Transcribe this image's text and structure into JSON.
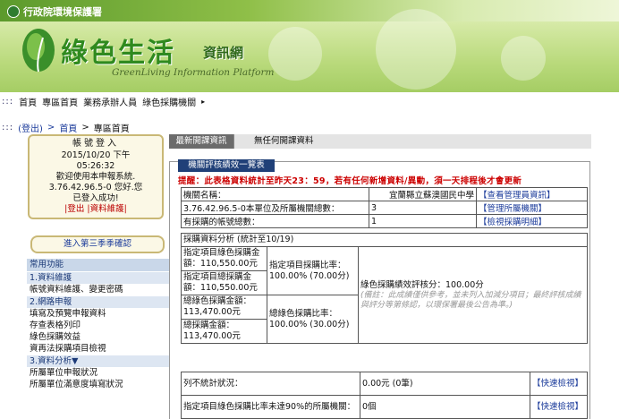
{
  "banner": {
    "agency": "行政院環境保護署",
    "title": "綠色生活",
    "title_sub": "資訊網",
    "tagline": "GreenLiving Information Platform"
  },
  "topnav": {
    "dots": ":::",
    "items": [
      "首頁",
      "專區首頁",
      "業務承辦人員",
      "綠色採購機關"
    ],
    "arrow": "▸"
  },
  "crumb": {
    "dots": ":::",
    "logout": "(登出)",
    "sep1": ">",
    "home": "首頁",
    "sep2": ">",
    "current": "專區首頁"
  },
  "login": {
    "header": "帳號登入",
    "date": "2015/10/20 下午",
    "time": "05:26:32",
    "welcome": "歡迎使用本申報系統.",
    "user": "3.76.42.96.5-0 您好.您",
    "status": "已登入成功!",
    "logout_link": "|登出",
    "account_link": "|資料維護|"
  },
  "season_button": "進入第三季季確認",
  "menu": {
    "header": "常用功能",
    "sections": [
      {
        "title": "1.資料維護",
        "items": [
          "帳號資料維護、變更密碼"
        ]
      },
      {
        "title": "2.網路申報",
        "items": [
          "填寫及預覽申報資料",
          "存查表格列印",
          "綠色採購效益",
          "資再法採購項目檢視"
        ]
      },
      {
        "title": "3.資料分析▼",
        "items": [
          "所屬單位申報狀況",
          "所屬單位滿意度填寫狀況"
        ]
      }
    ]
  },
  "tabs": {
    "active": "最新開課資訊",
    "inactive": "無任何開課資料"
  },
  "perf": {
    "tab_label": "機關評核績效一覽表",
    "warning": "提醒：此表格資料統計至昨天23：59，若有任何新增資料/異動，須一天排程後才會更新",
    "info_rows": [
      {
        "label": "機關名稱：",
        "value": "宜蘭縣立蘇澳國民中學",
        "link": "【查看管理員資訊】"
      },
      {
        "label": "3.76.42.96.5-0本單位及所屬機關總數：",
        "value": "3",
        "link": "【管理所屬機關】"
      },
      {
        "label": "有採購的帳號總數：",
        "value": "1",
        "link": "【檢視採購明細】"
      }
    ],
    "analysis_title": "採購資料分析 (統計至10/19)",
    "a1": "指定項目綠色採購金額：110,550.00元",
    "a2": "指定項目總採購金額：110,550.00元",
    "a3": "總綠色採購金額：113,470.00元",
    "a4": "總採購金額：113,470.00元",
    "ratio1": "指定項目採購比率：100.00% (70.00分)",
    "ratio2": "總綠色採購比率：100.00% (30.00分)",
    "score": "綠色採購績效評核分：100.00分",
    "note": "(備註：此成績僅供參考，並未列入加減分項目；最終評核成績與評分等第條認，以環保署最後公告為準。)",
    "bottom_rows": [
      {
        "label": "列不統計狀況：",
        "value": "0.00元 (0筆)",
        "link": "【快速檢視】"
      },
      {
        "label": "指定項目綠色採購比率未達90%的所屬機關：",
        "value": "0個",
        "link": "【快速檢視】"
      }
    ]
  },
  "colors": {
    "nav_blue": "#1a3a9a",
    "warning_red": "#c00000",
    "tab_dark": "#204078",
    "menu_header": "#c9d7e9"
  }
}
